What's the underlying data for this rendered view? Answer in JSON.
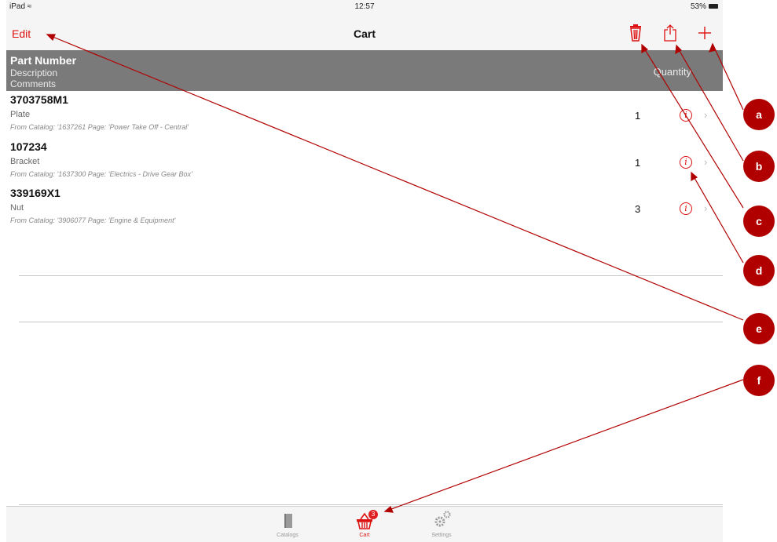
{
  "status_bar": {
    "device": "iPad",
    "wifi_icon": "wifi-icon",
    "time": "12:57",
    "battery": "53%"
  },
  "nav": {
    "edit_label": "Edit",
    "title": "Cart",
    "icons": [
      "trash-icon",
      "share-icon",
      "plus-icon"
    ]
  },
  "table_header": {
    "part_number": "Part Number",
    "description": "Description",
    "comments": "Comments",
    "quantity": "Quantity"
  },
  "rows": [
    {
      "part_number": "3703758M1",
      "description": "Plate",
      "comment": "From Catalog: '1637261  Page: 'Power Take Off - Central'",
      "quantity": "1"
    },
    {
      "part_number": "107234",
      "description": "Bracket",
      "comment": "From Catalog: '1637300  Page: 'Electrics - Drive Gear Box'",
      "quantity": "1"
    },
    {
      "part_number": "339169X1",
      "description": "Nut",
      "comment": "From Catalog: '3906077  Page: 'Engine & Equipment'",
      "quantity": "3"
    }
  ],
  "tabs": [
    {
      "label": "Catalogs",
      "icon": "book-icon"
    },
    {
      "label": "Cart",
      "icon": "basket-icon",
      "badge": "3",
      "active": true
    },
    {
      "label": "Settings",
      "icon": "gears-icon"
    }
  ],
  "callouts": [
    "a",
    "b",
    "c",
    "d",
    "e",
    "f"
  ],
  "colors": {
    "accent": "#dd1111",
    "callout": "#b10000",
    "header_bg": "#7a7a7a",
    "leader": "#b10000"
  }
}
